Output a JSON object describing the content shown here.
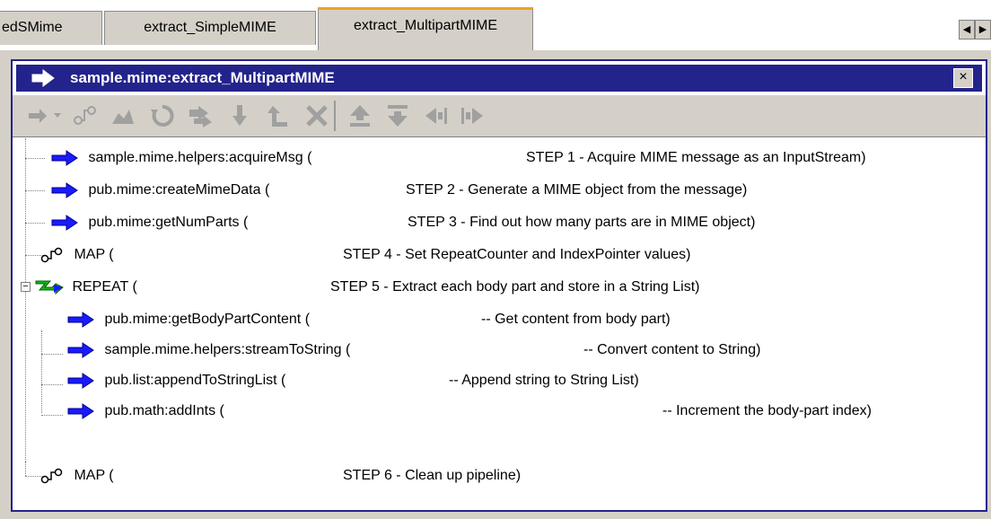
{
  "tabs": [
    {
      "label": "edSMime"
    },
    {
      "label": "extract_SimpleMIME"
    },
    {
      "label": "extract_MultipartMIME",
      "active": true
    }
  ],
  "panel": {
    "title": "sample.mime:extract_MultipartMIME",
    "close_label": "×"
  },
  "toolbar": {
    "buttons": [
      "invoke-menu",
      "map",
      "branch",
      "repeat",
      "loop",
      "sequence",
      "exit",
      "delete",
      "move-up",
      "move-down",
      "shift-left",
      "shift-right"
    ]
  },
  "tree": [
    {
      "type": "invoke",
      "label": "sample.mime.helpers:acquireMsg (",
      "comment": "STEP 1 - Acquire MIME message as an InputStream)"
    },
    {
      "type": "invoke",
      "label": "pub.mime:createMimeData (",
      "comment": "STEP 2 - Generate a MIME object from the message)"
    },
    {
      "type": "invoke",
      "label": "pub.mime:getNumParts (",
      "comment": "STEP 3 - Find out how many parts are in MIME object)"
    },
    {
      "type": "map",
      "label": "MAP (",
      "comment": "STEP 4 - Set RepeatCounter and IndexPointer values)"
    },
    {
      "type": "repeat",
      "label": "REPEAT (",
      "comment": "STEP 5 - Extract each body part and store in a String List)"
    },
    {
      "type": "invoke",
      "label": "pub.mime:getBodyPartContent (",
      "comment": "-- Get content from body part)"
    },
    {
      "type": "invoke",
      "label": "sample.mime.helpers:streamToString (",
      "comment": "-- Convert content to String)"
    },
    {
      "type": "invoke",
      "label": "pub.list:appendToStringList (",
      "comment": "-- Append string to String List)"
    },
    {
      "type": "invoke",
      "label": "pub.math:addInts (",
      "comment": "-- Increment the body-part index)"
    },
    {
      "type": "map",
      "label": "MAP (",
      "comment": "STEP 6 - Clean up pipeline)"
    }
  ],
  "colors": {
    "accent": "#23238c",
    "tab_highlight": "#f0a028",
    "invoke_arrow": "#1a1aff",
    "repeat_green": "#18b418"
  }
}
